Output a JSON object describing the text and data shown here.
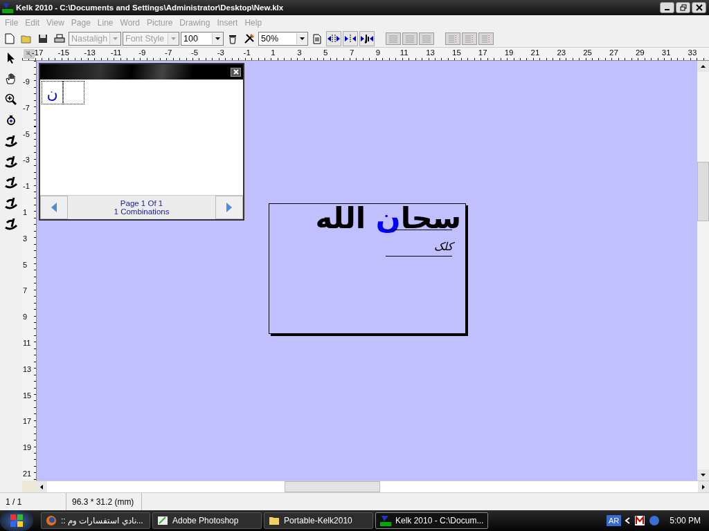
{
  "window": {
    "title": "Kelk 2010 - C:\\Documents and Settings\\Administrator\\Desktop\\New.klx"
  },
  "menu": [
    {
      "label": "File",
      "disabled": true
    },
    {
      "label": "Edit",
      "disabled": true
    },
    {
      "label": "View",
      "disabled": true
    },
    {
      "label": "Page",
      "disabled": true
    },
    {
      "label": "Line",
      "disabled": true
    },
    {
      "label": "Word",
      "disabled": true
    },
    {
      "label": "Picture",
      "disabled": true
    },
    {
      "label": "Drawing",
      "disabled": true
    },
    {
      "label": "Insert",
      "disabled": true
    },
    {
      "label": "Help",
      "disabled": true
    }
  ],
  "toolbar": {
    "font": {
      "value": "Nastaligh",
      "disabled": true
    },
    "font_style": {
      "value": "Font Style",
      "disabled": true
    },
    "size": {
      "value": "100",
      "disabled": false
    },
    "zoom": {
      "value": "50%",
      "disabled": false
    }
  },
  "ruler_h": [
    "-17",
    "-15",
    "-13",
    "-11",
    "-9",
    "-7",
    "-5",
    "-3",
    "-1",
    "1",
    "3",
    "5",
    "7",
    "9",
    "11",
    "13",
    "15",
    "17",
    "19",
    "21",
    "23",
    "25",
    "27",
    "29",
    "31",
    "33"
  ],
  "ruler_v": [
    "-9",
    "-7",
    "-5",
    "-3",
    "-1",
    "1",
    "3",
    "5",
    "7",
    "9",
    "11",
    "13",
    "15",
    "17",
    "19",
    "21"
  ],
  "combinations_panel": {
    "cells": [
      {
        "glyph": "ن"
      }
    ],
    "page": "Page 1 Of 1",
    "count": "1 Combinations"
  },
  "canvas": {
    "segments": [
      {
        "text": "سحا",
        "color": "#000000"
      },
      {
        "text": "ن",
        "color": "#0000ff"
      },
      {
        "text": " الله",
        "color": "#000000"
      }
    ],
    "signature": "کلک"
  },
  "status_bar": [
    "1 / 1",
    "96.3 * 31.2 (mm)"
  ],
  "taskbar": {
    "tasks": [
      {
        "label": ":: نادي استفسارات وم...",
        "selected": false,
        "kind": "browser"
      },
      {
        "label": "Adobe Photoshop",
        "selected": false,
        "kind": "photoshop"
      },
      {
        "label": "Portable-Kelk2010",
        "selected": false,
        "kind": "folder"
      },
      {
        "label": "Kelk 2010 - C:\\Docum...",
        "selected": true,
        "kind": "kelk"
      }
    ],
    "language": "AR",
    "clock": "5:00 PM"
  }
}
